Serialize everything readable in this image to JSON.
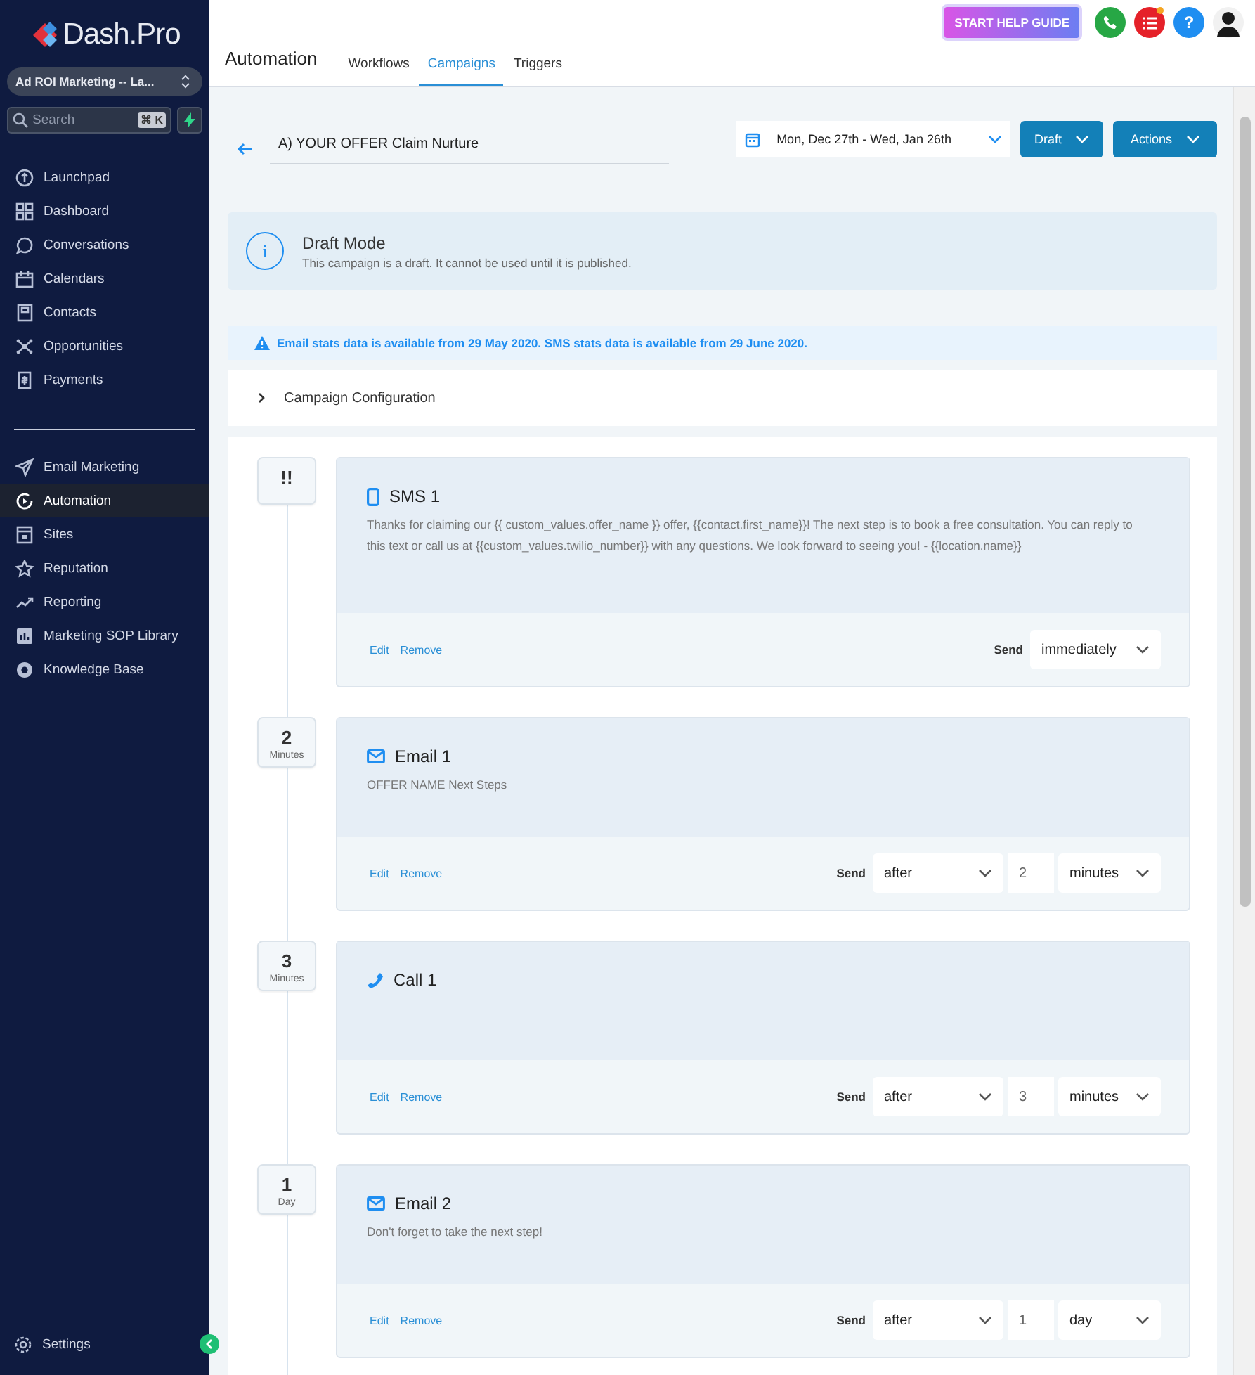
{
  "sidebar": {
    "logo": "Dash.Pro",
    "account": "Ad ROI Marketing -- La...",
    "search": {
      "placeholder": "Search",
      "shortcut": "⌘ K"
    },
    "groups": [
      {
        "items": [
          {
            "label": "Launchpad",
            "selected": false
          },
          {
            "label": "Dashboard",
            "selected": false
          },
          {
            "label": "Conversations",
            "selected": false
          },
          {
            "label": "Calendars",
            "selected": false
          },
          {
            "label": "Contacts",
            "selected": false
          },
          {
            "label": "Opportunities",
            "selected": false
          },
          {
            "label": "Payments",
            "selected": false
          }
        ]
      },
      {
        "items": [
          {
            "label": "Email Marketing",
            "selected": false
          },
          {
            "label": "Automation",
            "selected": true
          },
          {
            "label": "Sites",
            "selected": false
          },
          {
            "label": "Reputation",
            "selected": false
          },
          {
            "label": "Reporting",
            "selected": false
          },
          {
            "label": "Marketing SOP Library",
            "selected": false
          },
          {
            "label": "Knowledge Base",
            "selected": false
          }
        ]
      }
    ],
    "settings": "Settings"
  },
  "header": {
    "title": "Automation",
    "tabs": [
      {
        "label": "Workflows",
        "selected": false
      },
      {
        "label": "Campaigns",
        "selected": true
      },
      {
        "label": "Triggers",
        "selected": false
      }
    ],
    "help_button": "START HELP GUIDE",
    "help_icon": "?"
  },
  "campaign": {
    "name": "A) YOUR OFFER Claim Nurture",
    "date_range": "Mon, Dec 27th - Wed, Jan 26th",
    "buttons": [
      "Draft",
      "Actions"
    ]
  },
  "notice": {
    "title": "Draft Mode",
    "text": "This campaign is a draft. It cannot be used until it is published.",
    "icon": "i"
  },
  "alert": "Email stats data is available from 29 May 2020. SMS stats data is available from 29 June 2020.",
  "configuration": {
    "label": "Campaign Configuration",
    "expanded": false
  },
  "steps": [
    {
      "kind": "sms",
      "delay": "!!",
      "title": "SMS 1",
      "body": "Thanks for claiming our {{ custom_values.offer_name }} offer, {{contact.first_name}}! The next step is to book a free consultation. You can reply to this text or call us at {{custom_values.twilio_number}} with any questions. We look forward to seeing you! - {{location.name}}",
      "actions": [
        "Edit",
        "Remove"
      ],
      "send_label": "Send",
      "send": {
        "mode": "immediately"
      }
    },
    {
      "kind": "email",
      "delay": "2",
      "unit": "Minutes",
      "title": "Email 1",
      "body": "OFFER NAME Next Steps",
      "actions": [
        "Edit",
        "Remove"
      ],
      "send_label": "Send",
      "send": {
        "mode": "after",
        "amount": "2",
        "unit": "minutes"
      }
    },
    {
      "kind": "call",
      "delay": "3",
      "unit": "Minutes",
      "title": "Call 1",
      "actions": [
        "Edit",
        "Remove"
      ],
      "send_label": "Send",
      "send": {
        "mode": "after",
        "amount": "3",
        "unit": "minutes"
      }
    },
    {
      "kind": "email",
      "delay": "1",
      "unit": "Day",
      "title": "Email 2",
      "body": "Don't forget to take the next step!",
      "actions": [
        "Edit",
        "Remove"
      ],
      "send_label": "Send",
      "send": {
        "mode": "after",
        "amount": "1",
        "unit": "day"
      }
    }
  ]
}
